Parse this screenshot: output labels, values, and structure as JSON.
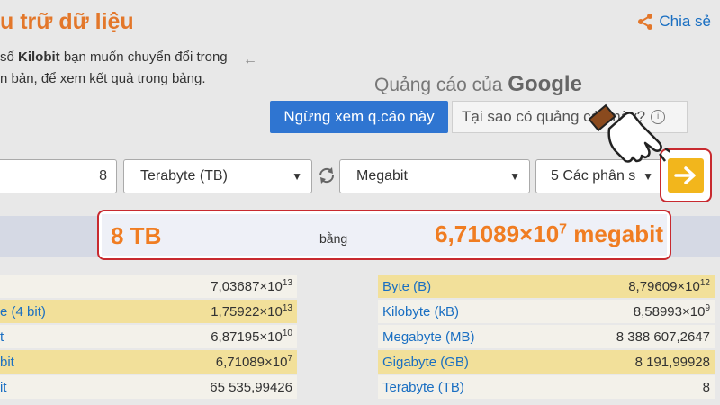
{
  "header": {
    "title": "u trữ dữ liệu",
    "share_label": "Chia sẻ"
  },
  "instructions": {
    "line1_prefix": "số ",
    "line1_bold": "Kilobit",
    "line1_suffix": " bạn muốn chuyển đổi trong",
    "line2": "n bản, để xem kết quả trong bảng."
  },
  "ad": {
    "label_prefix": "Quảng cáo của ",
    "label_brand": "Google",
    "stop_button": "Ngừng xem q.cáo này",
    "why_button": "Tại sao có quảng cáo này?"
  },
  "converter": {
    "value": "8",
    "from_unit": "Terabyte (TB)",
    "to_unit": "Megabit",
    "precision": "5 Các phân s",
    "colors": {
      "accent": "#f2b61c",
      "highlight_border": "#c82a2f",
      "result_text": "#f07d22"
    }
  },
  "result": {
    "input": "8 TB",
    "equals": "bằng",
    "mantissa": "6,71089×10",
    "exponent": "7",
    "unit": " megabit"
  },
  "left_table": [
    {
      "name": "",
      "mantissa": "7,03687×10",
      "exp": "13",
      "style": "pale"
    },
    {
      "name": "e (4 bit)",
      "mantissa": "1,75922×10",
      "exp": "13",
      "style": "yel"
    },
    {
      "name": "t",
      "mantissa": "6,87195×10",
      "exp": "10",
      "style": "pale"
    },
    {
      "name": "bit",
      "mantissa": "6,71089×10",
      "exp": "7",
      "style": "yel"
    },
    {
      "name": "it",
      "mantissa": "65 535,99426",
      "exp": "",
      "style": "pale"
    }
  ],
  "right_table": [
    {
      "name": "Byte (B)",
      "mantissa": "8,79609×10",
      "exp": "12",
      "style": "yel"
    },
    {
      "name": "Kilobyte (kB)",
      "mantissa": "8,58993×10",
      "exp": "9",
      "style": "pale"
    },
    {
      "name": "Megabyte (MB)",
      "mantissa": "8 388 607,2647",
      "exp": "",
      "style": "pale"
    },
    {
      "name": "Gigabyte (GB)",
      "mantissa": "8 191,99928",
      "exp": "",
      "style": "yel"
    },
    {
      "name": "Terabyte (TB)",
      "mantissa": "8",
      "exp": "",
      "style": "pale"
    }
  ]
}
